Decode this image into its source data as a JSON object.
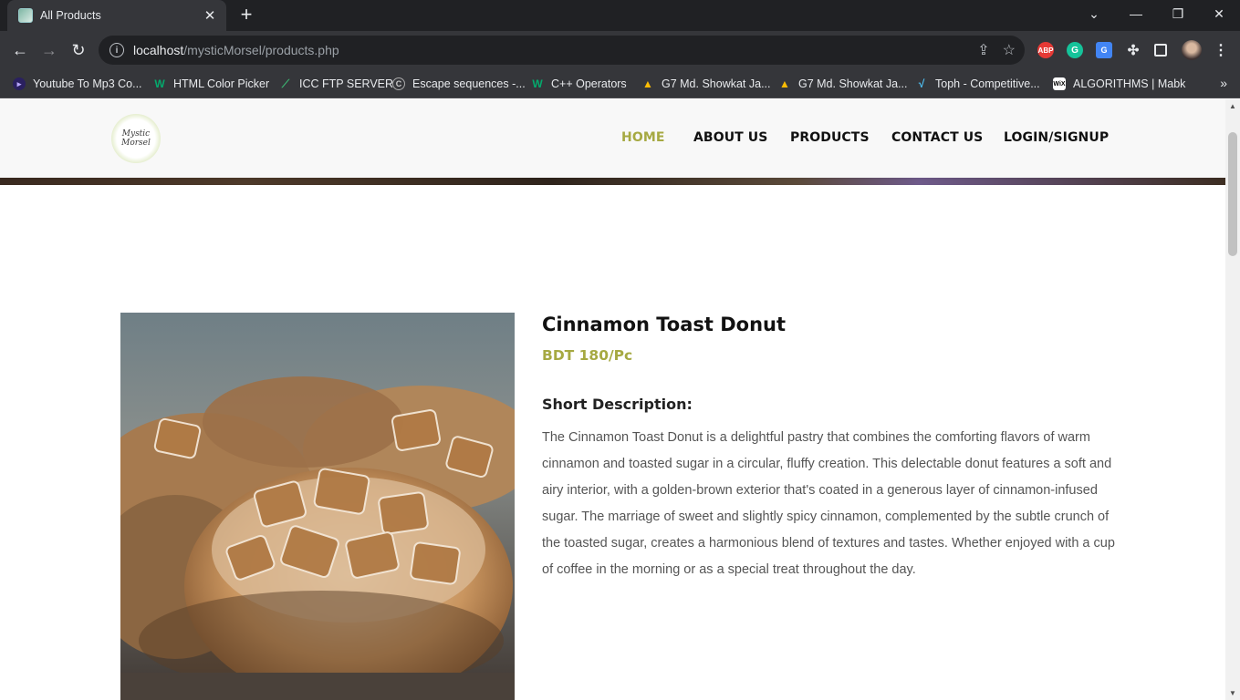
{
  "browser": {
    "tab_title": "All Products",
    "url_host": "localhost",
    "url_path": "/mysticMorsel/products.php",
    "bookmarks": [
      {
        "label": "Youtube To Mp3 Co...",
        "icon": "play-circle-icon",
        "color": "#6a5acd"
      },
      {
        "label": "HTML Color Picker",
        "icon": "w3schools-icon",
        "color": "#04aa6d"
      },
      {
        "label": "ICC FTP SERVER",
        "icon": "feather-icon",
        "color": "#2e8b57"
      },
      {
        "label": "Escape sequences -...",
        "icon": "cpp-icon",
        "color": "#777777"
      },
      {
        "label": "C++ Operators",
        "icon": "w3schools-icon",
        "color": "#04aa6d"
      },
      {
        "label": "G7 Md. Showkat Ja...",
        "icon": "google-drive-icon",
        "color": "#fbbc04"
      },
      {
        "label": "G7 Md. Showkat Ja...",
        "icon": "google-drive-icon",
        "color": "#fbbc04"
      },
      {
        "label": "Toph - Competitive...",
        "icon": "toph-icon",
        "color": "#4fc3f7"
      },
      {
        "label": "ALGORITHMS | Mabk",
        "icon": "wix-icon",
        "color": "#ffffff"
      }
    ]
  },
  "site": {
    "logo_line1": "Mystic",
    "logo_line2": "Morsel",
    "nav": [
      {
        "label": "HOME",
        "active": true
      },
      {
        "label": "ABOUT US",
        "active": false
      },
      {
        "label": "PRODUCTS",
        "active": false
      },
      {
        "label": "CONTACT US",
        "active": false
      },
      {
        "label": "LOGIN/SIGNUP",
        "active": false
      }
    ],
    "accent_color": "#a6a942"
  },
  "product": {
    "name": "Cinnamon Toast Donut",
    "price": "BDT 180/Pc",
    "desc_heading": "Short Description:",
    "description": "The Cinnamon Toast Donut is a delightful pastry that combines the comforting flavors of warm cinnamon and toasted sugar in a circular, fluffy creation. This delectable donut features a soft and airy interior, with a golden-brown exterior that's coated in a generous layer of cinnamon-infused sugar. The marriage of sweet and slightly spicy cinnamon, complemented by the subtle crunch of the toasted sugar, creates a harmonious blend of textures and tastes. Whether enjoyed with a cup of coffee in the morning or as a special treat throughout the day."
  }
}
